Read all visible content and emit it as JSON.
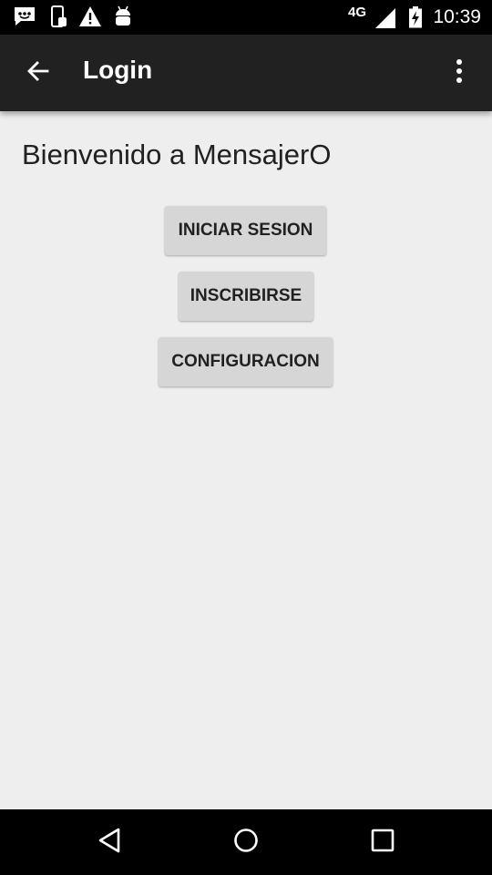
{
  "status_bar": {
    "time": "10:39",
    "network": "4G",
    "icons": [
      "message-icon",
      "phone-notification-icon",
      "warning-icon",
      "android-icon",
      "signal-icon",
      "battery-charging-icon"
    ]
  },
  "app_bar": {
    "title": "Login",
    "back_icon": "arrow-back-icon",
    "menu_icon": "more-vert-icon"
  },
  "main": {
    "welcome_text": "Bienvenido a MensajerO",
    "buttons": [
      {
        "label": "INICIAR SESION"
      },
      {
        "label": "INSCRIBIRSE"
      },
      {
        "label": "CONFIGURACION"
      }
    ]
  },
  "nav_bar": {
    "icons": [
      "back-triangle-icon",
      "home-circle-icon",
      "recents-square-icon"
    ]
  },
  "colors": {
    "status_bar": "#000000",
    "app_bar": "#212121",
    "background": "#eeeeee",
    "button": "#d6d6d6",
    "text": "#212121"
  }
}
